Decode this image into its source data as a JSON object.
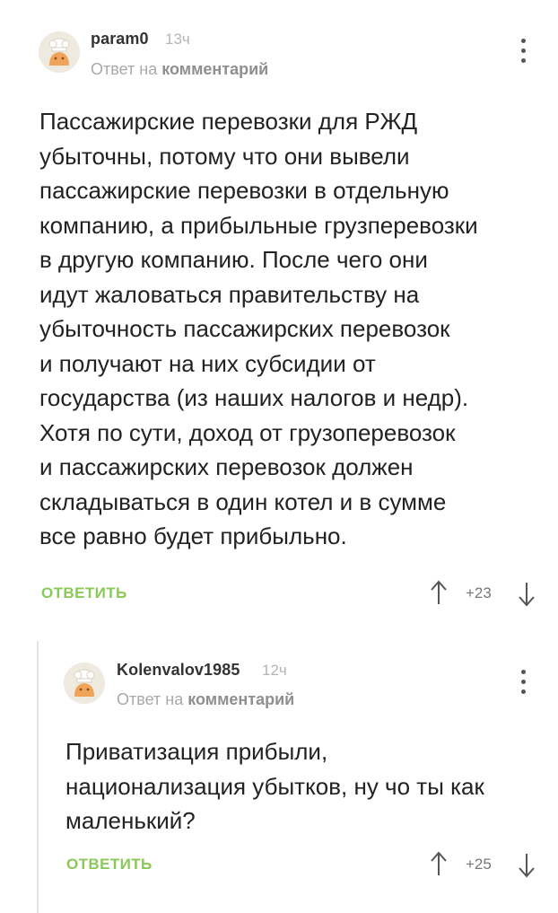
{
  "comments": [
    {
      "username": "param0",
      "time": "13ч",
      "reply_prefix": "Ответ на",
      "reply_link": "комментарий",
      "avatar_icon": "default-user-avatar-icon",
      "text_lines": [
        "Пассажирские перевозки для РЖД",
        "убыточны, потому что они вывели",
        "пассажирские перевозки в отдельную",
        "компанию, а прибыльные грузперевозки",
        "в другую компанию. После чего они",
        "идут жаловаться правительству на",
        "убыточность пассажирских перевозок",
        "и получают на них субсидии от",
        "государства (из наших налогов и недр).",
        "Хотя по сути, доход от грузоперевозок",
        "и пассажирских перевозок должен",
        "складываться в один котел и в сумме",
        "все равно будет прибыльно."
      ],
      "reply_label": "ОТВЕТИТЬ",
      "rating": "+23"
    },
    {
      "username": "Kolenvalov1985",
      "time": "12ч",
      "reply_prefix": "Ответ на",
      "reply_link": "комментарий",
      "avatar_icon": "default-user-avatar-icon",
      "text_lines": [
        "Приватизация прибыли,",
        "национализация убытков, ну чо ты как",
        "маленький?"
      ],
      "reply_label": "ОТВЕТИТЬ",
      "rating": "+25"
    }
  ],
  "colors": {
    "reply_button": "#8ac858",
    "meta_text": "#a9a9a9",
    "body_text": "#222222",
    "thread_line": "#e3e3e3"
  }
}
